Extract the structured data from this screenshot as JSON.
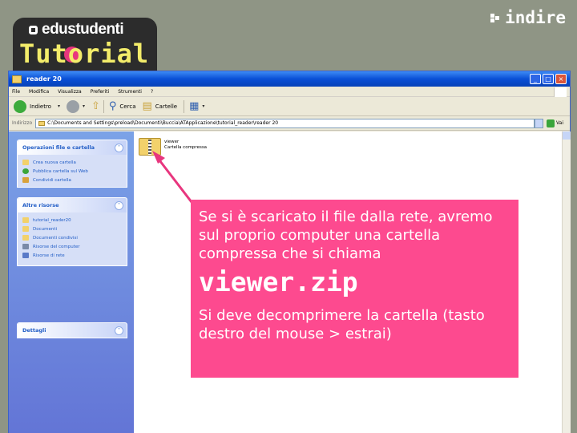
{
  "branding": {
    "top_label": "edustudenti",
    "tutorial_label": "Tutorial",
    "partner_logo": "indire",
    "accent": "#e8367e",
    "tutorial_color": "#f3ec6a"
  },
  "window": {
    "title": "reader 20",
    "controls": [
      "_",
      "□",
      "×"
    ]
  },
  "menu": [
    "File",
    "Modifica",
    "Visualizza",
    "Preferiti",
    "Strumenti",
    "?"
  ],
  "toolbar": {
    "back": "Indietro",
    "search": "Cerca",
    "folders": "Cartelle"
  },
  "address": {
    "label": "Indirizzo",
    "path": "C:\\Documents and Settings\\preload\\Documenti\\Buccia\\ATApplicazione\\tutorial_reader\\reader 20",
    "go_label": "Vai"
  },
  "sidebar": {
    "folder_tasks": {
      "title": "Operazioni file e cartella",
      "items": [
        "Crea nuova cartella",
        "Pubblica cartella sul Web",
        "Condividi cartella"
      ]
    },
    "other_places": {
      "title": "Altre risorse",
      "items": [
        "tutorial_reader20",
        "Documenti",
        "Documenti condivisi",
        "Risorse del computer",
        "Risorse di rete"
      ]
    },
    "details": {
      "title": "Dettagli"
    }
  },
  "file": {
    "name": "viewer",
    "type": "Cartella compressa"
  },
  "callout": {
    "line1": "Se si è scaricato il file dalla rete, avremo sul proprio computer una cartella compressa che si chiama",
    "filename": "viewer.zip",
    "line2": "Si deve decomprimere la cartella (tasto destro del mouse > estrai)",
    "bg_color": "#fd4a8f"
  }
}
